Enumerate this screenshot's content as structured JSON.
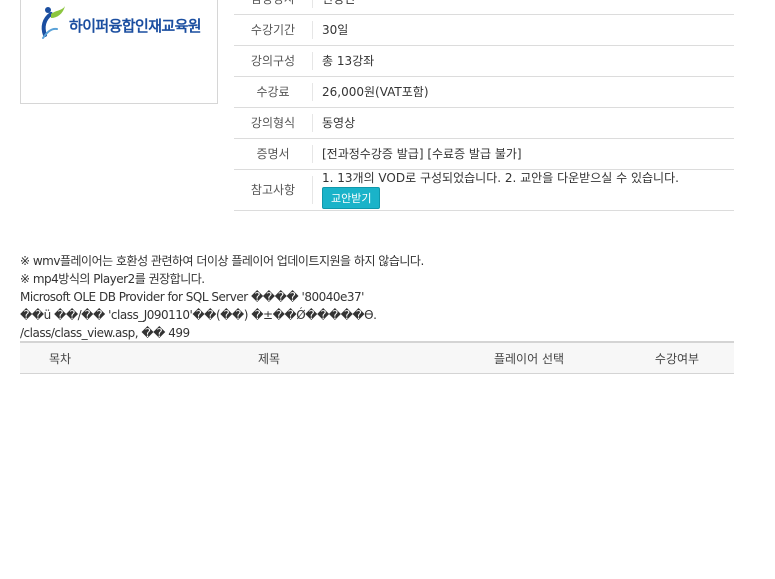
{
  "logo": {
    "text": "하이퍼융합인재교육원"
  },
  "info": {
    "rows": [
      {
        "label": "담당강사",
        "value": "전성민"
      },
      {
        "label": "수강기간",
        "value": "30일"
      },
      {
        "label": "강의구성",
        "value": "총 13강좌"
      },
      {
        "label": "수강료",
        "value": "26,000원(VAT포함)"
      },
      {
        "label": "강의형식",
        "value": "동영상"
      },
      {
        "label": "증명서",
        "value": "[전과정수강증 발급] [수료증 발급 불가]"
      }
    ],
    "notes": {
      "label": "참고사항",
      "text": "1. 13개의 VOD로 구성되었습니다. 2. 교안을 다운받으실 수 있습니다.",
      "button": "교안받기"
    }
  },
  "notices": [
    "※ wmv플레이어는 호환성 관련하여 더이상 플레이어 업데이트지원을 하지 않습니다.",
    "※ mp4방식의 Player2를 권장합니다.",
    "Microsoft OLE DB Provider for SQL Server ���� '80040e37'",
    "��ü ��/�� 'class_J090110'��(��) �±��Ǿ�����Ө.",
    "/class/class_view.asp, �� 499"
  ],
  "list_table": {
    "headers": [
      "목차",
      "제목",
      "플레이어 선택",
      "수강여부"
    ]
  },
  "colors": {
    "brand": "#1b4ea0",
    "accent": "#1ab3c9",
    "logo_leaf": "#8cc63f"
  }
}
